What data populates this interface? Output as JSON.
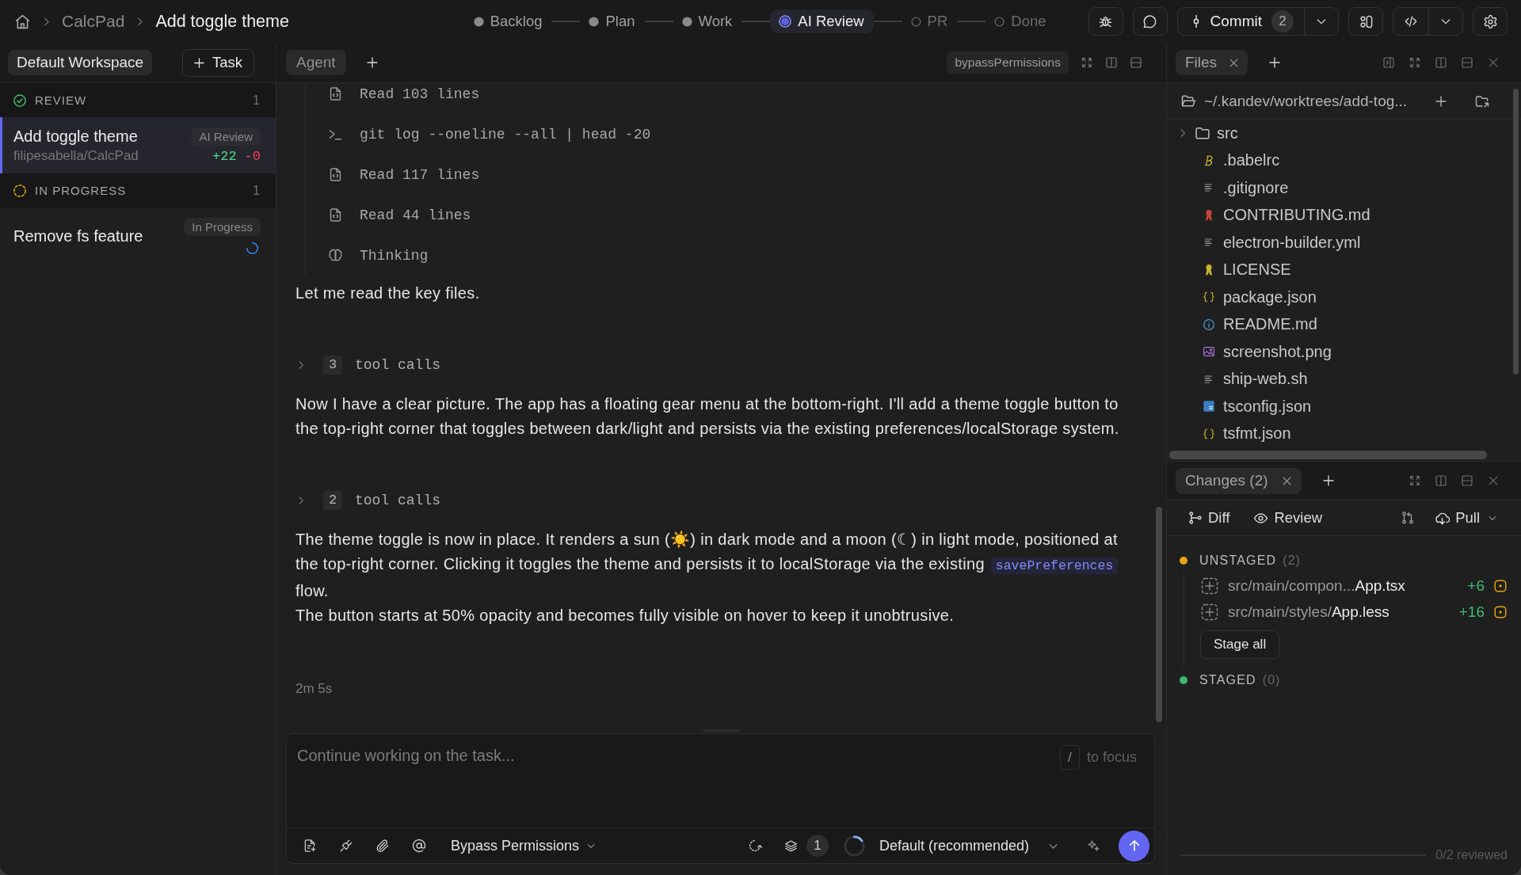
{
  "top_bar": {
    "project": "CalcPad",
    "task": "Add toggle theme",
    "steps": [
      {
        "label": "Backlog",
        "done": true,
        "selected": false
      },
      {
        "label": "Plan",
        "done": true,
        "selected": false
      },
      {
        "label": "Work",
        "done": true,
        "selected": false
      },
      {
        "label": "AI Review",
        "done": false,
        "selected": true
      },
      {
        "label": "PR",
        "done": false,
        "selected": false
      },
      {
        "label": "Done",
        "done": false,
        "selected": false
      }
    ],
    "commit": {
      "label": "Commit",
      "count": "2"
    }
  },
  "sidebar": {
    "workspace": "Default Workspace",
    "new_task": "Task",
    "groups": [
      {
        "kind": "review",
        "title": "REVIEW",
        "count": "1",
        "tasks": [
          {
            "title": "Add toggle theme",
            "repo": "filipesabella/CalcPad",
            "status": "AI Review",
            "added": "+22",
            "removed": "-0",
            "selected": true,
            "running": false
          }
        ]
      },
      {
        "kind": "in_progress",
        "title": "IN PROGRESS",
        "count": "1",
        "tasks": [
          {
            "title": "Remove fs feature",
            "status": "In Progress",
            "selected": false,
            "running": true
          }
        ]
      }
    ]
  },
  "agent": {
    "tab": "Agent",
    "mode": "bypassPermissions",
    "messages": [
      {
        "kind": "tool_calls",
        "calls": [
          {
            "kind": "read",
            "text": "Read 103 lines"
          },
          {
            "kind": "command",
            "text": "git log --oneline --all | head -20"
          },
          {
            "kind": "read",
            "text": "Read 117 lines"
          },
          {
            "kind": "read",
            "text": "Read 44 lines"
          },
          {
            "kind": "thinking",
            "text": "Thinking"
          }
        ]
      },
      {
        "kind": "paragraph",
        "parts": [
          {
            "kind": "text",
            "text": "Let me read the key files."
          }
        ]
      },
      {
        "kind": "tool_group",
        "count": "3",
        "label": "tool calls",
        "expanded": false
      },
      {
        "kind": "paragraph",
        "parts": [
          {
            "kind": "text",
            "text": "Now I have a clear picture. The app has a floating gear menu at the bottom-right. I'll add a theme toggle button to the top-right corner that toggles between dark/light and persists via the existing preferences/localStorage system."
          }
        ]
      },
      {
        "kind": "tool_group",
        "count": "2",
        "label": "tool calls",
        "expanded": false
      },
      {
        "kind": "paragraph",
        "parts": [
          {
            "kind": "text",
            "text": "The theme toggle is now in place. It renders a sun (☀️) in dark mode and a moon (☾) in light mode, positioned at the top-right corner. Clicking it toggles the theme and persists it to localStorage via the existing "
          },
          {
            "kind": "code",
            "text": "savePreferences"
          },
          {
            "kind": "text",
            "text": " flow."
          }
        ]
      },
      {
        "kind": "paragraph",
        "parts": [
          {
            "kind": "text",
            "text": "The button starts at 50% opacity and becomes fully visible on hover to keep it unobtrusive."
          }
        ]
      }
    ],
    "duration": "2m 5s",
    "composer": {
      "placeholder": "Continue working on the task...",
      "shortcut_key": "/",
      "shortcut_hint": "to focus",
      "permission": "Bypass Permissions",
      "queue_count": "1",
      "context_meter": {
        "level": 0.15
      },
      "model": "Default (recommended)"
    }
  },
  "files": {
    "tab": "Files",
    "path": "~/.kandev/worktrees/add-tog...",
    "tree": [
      {
        "name": "src",
        "kind": "folder",
        "expanded": false
      },
      {
        "name": ".babelrc",
        "kind": "babel"
      },
      {
        "name": ".gitignore",
        "kind": "text"
      },
      {
        "name": "CONTRIBUTING.md",
        "kind": "contributing"
      },
      {
        "name": "electron-builder.yml",
        "kind": "text"
      },
      {
        "name": "LICENSE",
        "kind": "license"
      },
      {
        "name": "package.json",
        "kind": "json"
      },
      {
        "name": "README.md",
        "kind": "readme"
      },
      {
        "name": "screenshot.png",
        "kind": "image"
      },
      {
        "name": "ship-web.sh",
        "kind": "text"
      },
      {
        "name": "tsconfig.json",
        "kind": "typescript"
      },
      {
        "name": "tsfmt.json",
        "kind": "json"
      }
    ]
  },
  "changes": {
    "tab": "Changes (2)",
    "actions": {
      "diff": "Diff",
      "review": "Review",
      "pull": "Pull"
    },
    "sections": [
      {
        "title": "UNSTAGED",
        "count": "(2)",
        "color": "#e8a317",
        "files": [
          {
            "dir": "src/main/compon...",
            "name": "App.tsx",
            "added": "+6"
          },
          {
            "dir": "src/main/styles/",
            "name": "App.less",
            "added": "+16"
          }
        ],
        "action": "Stage all"
      },
      {
        "title": "STAGED",
        "count": "(0)",
        "color": "#3fb96f"
      }
    ],
    "review": {
      "label": "0/2 reviewed"
    }
  }
}
